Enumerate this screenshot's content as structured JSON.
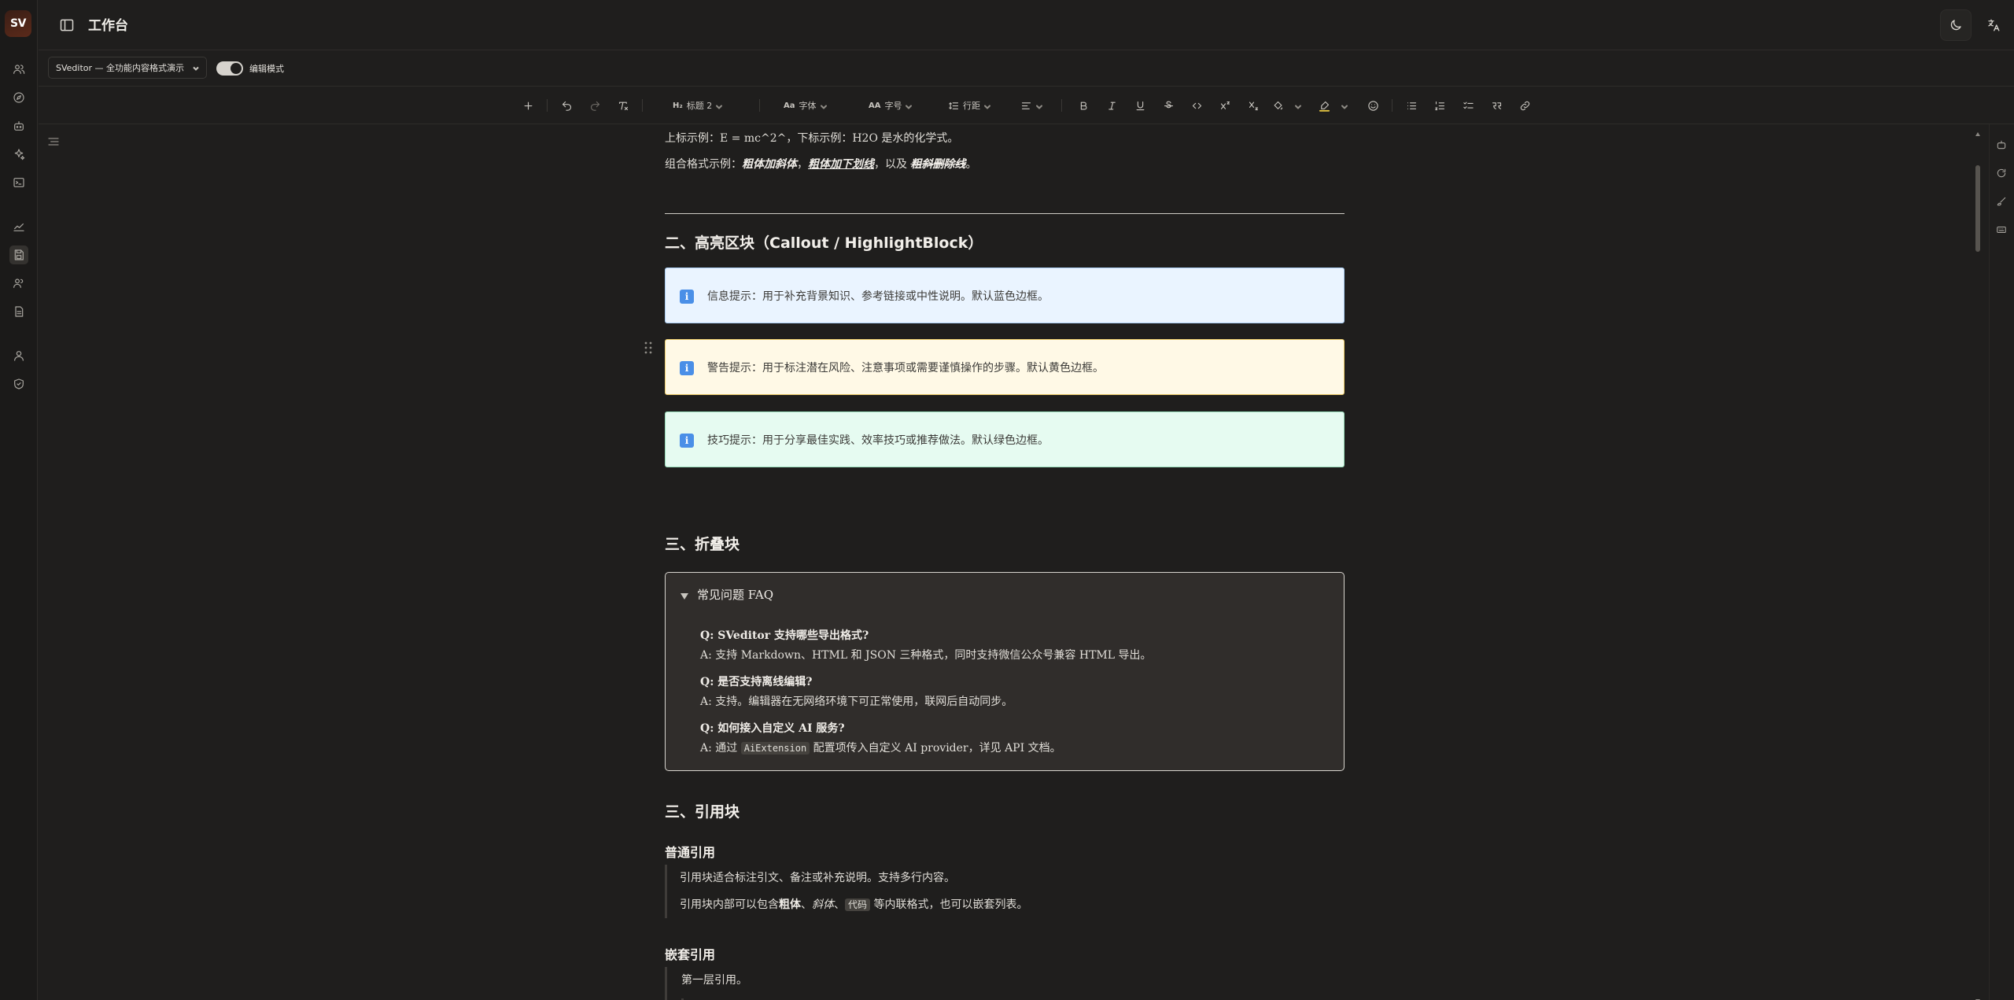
{
  "app": {
    "logo": "SV",
    "title": "工作台"
  },
  "rail": {
    "icons": [
      "users-icon",
      "compass-icon",
      "bot-icon",
      "sparkles-icon",
      "terminal-icon",
      "chart-icon",
      "save-icon",
      "team-icon",
      "file-icon",
      "user-icon",
      "shield-icon"
    ]
  },
  "subbar": {
    "document_selected": "SVeditor — 全功能内容格式演示",
    "mode_label": "编辑模式",
    "mode_on": true
  },
  "toolbar": {
    "heading": "标题 2",
    "heading_prefix": "H₂",
    "font": "字体",
    "font_prefix": "Aa",
    "size": "字号",
    "size_prefix": "AA",
    "line_height": "行距"
  },
  "content": {
    "line_sup": "上标示例：E = mc^2^，下标示例：H2O 是水的化学式。",
    "combo_prefix": "组合格式示例：",
    "combo_1": "粗体加斜体",
    "combo_sep1": "，",
    "combo_2": "粗体加下划线",
    "combo_sep2": "，以及 ",
    "combo_3": "粗斜删除线",
    "combo_end": "。",
    "h_callout": "二、高亮区块（Callout / HighlightBlock）",
    "callout_info": "信息提示：用于补充背景知识、参考链接或中性说明。默认蓝色边框。",
    "callout_warn": "警告提示：用于标注潜在风险、注意事项或需要谨慎操作的步骤。默认黄色边框。",
    "callout_tip": "技巧提示：用于分享最佳实践、效率技巧或推荐做法。默认绿色边框。",
    "callout_icon": "i",
    "h_fold": "三、折叠块",
    "faq_title": "常见问题 FAQ",
    "faq": [
      {
        "q": "Q: SVeditor 支持哪些导出格式?",
        "a": "A: 支持 Markdown、HTML 和 JSON 三种格式，同时支持微信公众号兼容 HTML 导出。"
      },
      {
        "q": "Q: 是否支持离线编辑?",
        "a": "A: 支持。编辑器在无网络环境下可正常使用，联网后自动同步。"
      },
      {
        "q": "Q: 如何接入自定义 AI 服务?",
        "a_prefix": "A: 通过 ",
        "a_code": "AiExtension",
        "a_suffix": " 配置项传入自定义 AI provider，详见 API 文档。"
      }
    ],
    "h_quote": "三、引用块",
    "h_normal_quote": "普通引用",
    "quote_line1": "引用块适合标注引文、备注或补充说明。支持多行内容。",
    "quote_line2_prefix": "引用块内部可以包含",
    "quote_bold": "粗体",
    "quote_sep1": "、",
    "quote_italic": "斜体",
    "quote_sep2": "、",
    "quote_code": "代码",
    "quote_line2_suffix": " 等内联格式，也可以嵌套列表。",
    "h_nested_quote": "嵌套引用",
    "nested_line1": "第一层引用。"
  },
  "colors": {
    "background": "#1f1e1d",
    "info_bg": "#eaf4ff",
    "info_border": "#a9cdf3",
    "warn_bg": "#fff9e6",
    "warn_border": "#efcf6b",
    "tip_bg": "#e6fbf1",
    "tip_border": "#97dcb9",
    "icon_blue": "#4a8fe7"
  }
}
